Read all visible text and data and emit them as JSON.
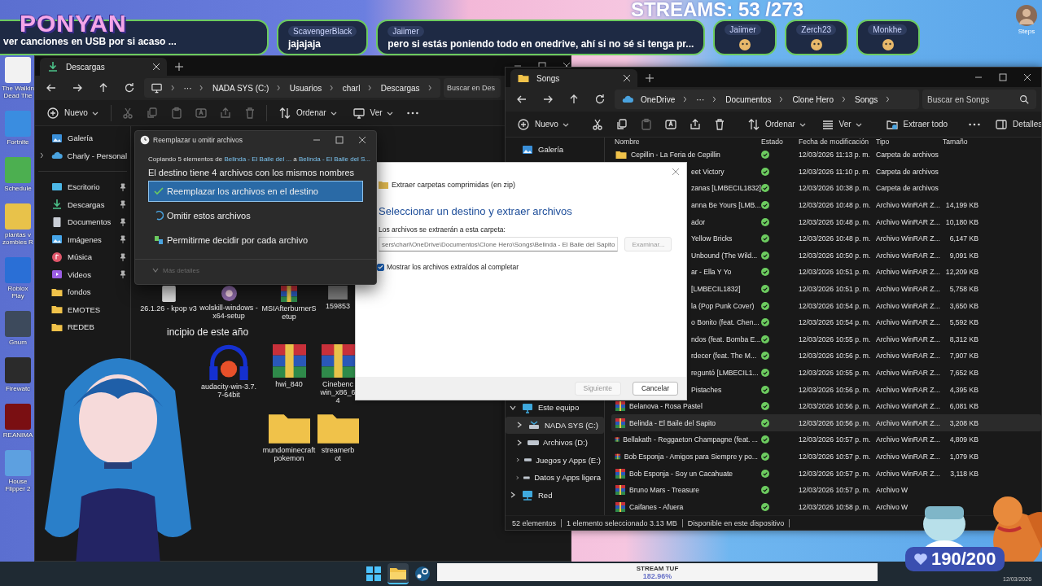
{
  "overlay": {
    "logo": "PONYAN",
    "chat": [
      {
        "kind": "message",
        "text": "ver canciones en USB por si acaso ..."
      },
      {
        "kind": "message",
        "user": "ScavengerBlack",
        "text": "jajajaja"
      },
      {
        "kind": "message",
        "user": "Jaiimer",
        "text": "pero si estás poniendo todo en onedrive, ahí si no sé si tenga pr..."
      },
      {
        "kind": "emote",
        "user": "Jaiimer"
      },
      {
        "kind": "emote",
        "user": "Zerch23"
      },
      {
        "kind": "emote",
        "user": "Monkhe"
      }
    ],
    "streams_counter": "STREAMS: 53 /273",
    "corner_label": "Steps",
    "stream_bar": {
      "label": "STREAM TUF",
      "value": "182.96%",
      "level": 1
    },
    "goal": "190/200",
    "date": "12/03/2026"
  },
  "desktop_icons": [
    {
      "label": "The Walkin Dead The",
      "color": "#f2f2f2"
    },
    {
      "label": "Fortnite",
      "color": "#3a8de0"
    },
    {
      "label": "Schedule",
      "color": "#4caf50"
    },
    {
      "label": "plantas v zombies R",
      "color": "#e8c24a"
    },
    {
      "label": "Roblox Play",
      "color": "#2a6fd6"
    },
    {
      "label": "Gnum",
      "color": "#3d4a5c"
    },
    {
      "label": "Firewatc",
      "color": "#2b2b2b"
    },
    {
      "label": "REANIMA",
      "color": "#7a0f12"
    },
    {
      "label": "House Flipper 2",
      "color": "#5da0e0"
    }
  ],
  "downloads_window": {
    "tab": "Descargas",
    "hidden_crumbs": "···",
    "breadcrumb": [
      "NADA SYS (C:)",
      "Usuarios",
      "charl",
      "Descargas"
    ],
    "search": {
      "placeholder": "Buscar en Des"
    },
    "toolbar": {
      "new": "Nuevo",
      "sort": "Ordenar",
      "view": "Ver"
    },
    "sidebar": [
      {
        "label": "Galería",
        "kind": "gallery",
        "pinned": false
      },
      {
        "label": "Charly - Personal",
        "kind": "cloud",
        "pinned": false
      },
      {
        "label": "Escritorio",
        "kind": "desktop",
        "pinned": true
      },
      {
        "label": "Descargas",
        "kind": "download",
        "pinned": true
      },
      {
        "label": "Documentos",
        "kind": "document",
        "pinned": true
      },
      {
        "label": "Imágenes",
        "kind": "pictures",
        "pinned": true
      },
      {
        "label": "Música",
        "kind": "music",
        "pinned": true
      },
      {
        "label": "Videos",
        "kind": "videos",
        "pinned": true
      },
      {
        "label": "fondos",
        "kind": "folder",
        "pinned": false
      },
      {
        "label": "EMOTES",
        "kind": "folder",
        "pinned": false
      },
      {
        "label": "REDEB",
        "kind": "folder",
        "pinned": false
      }
    ],
    "sections": [
      {
        "items": [
          {
            "kind": "file",
            "label": "26.1.26 - kpop v3"
          },
          {
            "kind": "installer",
            "label": "wolskill-windows -x64-setup"
          },
          {
            "kind": "archive",
            "label": "MSIAfterburnerS etup"
          },
          {
            "kind": "image",
            "label": "159853"
          }
        ]
      },
      {
        "heading": "incipio de este año",
        "items": [
          {
            "kind": "covered"
          },
          {
            "kind": "audio",
            "label": "audacity-win-3.7. 7-64bit"
          },
          {
            "kind": "archive",
            "label": "hwi_840"
          },
          {
            "kind": "archive",
            "label": "Cinebenc win_x86_64"
          }
        ]
      },
      {
        "items": [
          {
            "kind": "covered"
          },
          {
            "kind": "covered"
          },
          {
            "kind": "folder",
            "label": "mundominecraft pokemon"
          },
          {
            "kind": "folder",
            "label": "streamerbot"
          }
        ]
      }
    ]
  },
  "replace_dialog": {
    "title": "Reemplazar u omitir archivos",
    "subtitle": {
      "prefix": "Copiando 5 elementos de ",
      "source": "Belinda - El Baile del ...",
      "middle": " a ",
      "target": "Belinda - El Baile del S..."
    },
    "heading": "El destino tiene 4 archivos con los mismos nombres",
    "options": [
      {
        "kind": "replace",
        "label": "Reemplazar los archivos en el destino",
        "selected": true
      },
      {
        "kind": "skip",
        "label": "Omitir estos archivos",
        "selected": false
      },
      {
        "kind": "decide",
        "label": "Permitirme decidir por cada archivo",
        "selected": false
      }
    ],
    "details": {
      "label": "Más detalles",
      "disabled": true
    }
  },
  "extract_dialog": {
    "title": "Extraer carpetas comprimidas (en zip)",
    "heading": "Seleccionar un destino y extraer archivos",
    "field_label": "Los archivos se extraerán a esta carpeta:",
    "path": "sers\\charl\\OneDrive\\Documentos\\Clone Hero\\Songs\\Belinda - El Baile del Sapito",
    "browse": {
      "label": "Examinar...",
      "disabled": true
    },
    "show_files": {
      "label": "Mostrar los archivos extraídos al completar",
      "checked": true
    },
    "buttons": [
      {
        "label": "Siguiente",
        "disabled": true
      },
      {
        "label": "Cancelar",
        "disabled": false
      }
    ]
  },
  "songs_window": {
    "tab": "Songs",
    "hidden_crumbs": "···",
    "breadcrumb": [
      "OneDrive",
      "Documentos",
      "Clone Hero",
      "Songs"
    ],
    "search": {
      "placeholder": "Buscar en Songs"
    },
    "toolbar": {
      "new": "Nuevo",
      "sort": "Ordenar",
      "view": "Ver",
      "extract": "Extraer todo",
      "details": "Detalles"
    },
    "sidebar_top": [
      {
        "label": "Galería",
        "kind": "gallery"
      }
    ],
    "sidebar_bottom": [
      {
        "label": "Este equipo",
        "kind": "pc",
        "expanded": true,
        "selected": false,
        "children": [
          {
            "label": "NADA SYS (C:)",
            "kind": "system-drive",
            "expanded": false,
            "selected": true
          },
          {
            "label": "Archivos (D:)",
            "kind": "drive",
            "expanded": false,
            "selected": false
          },
          {
            "label": "Juegos y Apps  (E:)",
            "kind": "drive",
            "expanded": false,
            "selected": false
          },
          {
            "label": "Datos y Apps ligera",
            "kind": "drive",
            "expanded": false,
            "selected": false
          }
        ]
      },
      {
        "label": "Red",
        "kind": "network",
        "expanded": false,
        "selected": false
      }
    ],
    "columns": [
      "Nombre",
      "Estado",
      "Fecha de modificación",
      "Tipo",
      "Tamaño"
    ],
    "rows": [
      {
        "kind": "folder",
        "name": "Cepillin - La Feria de Cepillin",
        "synced": true,
        "date": "12/03/2026 11:13 p. m.",
        "type": "Carpeta de archivos",
        "selected": false
      },
      {
        "kind": "partial",
        "name": "eet Victory",
        "synced": true,
        "date": "12/03/2026 11:10 p. m.",
        "type": "Carpeta de archivos",
        "selected": false
      },
      {
        "kind": "partial",
        "name": "zanas [LMBECIL1832]",
        "synced": true,
        "date": "12/03/2026 10:38 p. m.",
        "type": "Carpeta de archivos",
        "selected": false
      },
      {
        "kind": "partial",
        "name": "anna Be Yours [LMB...",
        "synced": true,
        "date": "12/03/2026 10:48 p. m.",
        "type": "Archivo WinRAR Z...",
        "size": "14,199 KB",
        "selected": false
      },
      {
        "kind": "partial",
        "name": "ador",
        "synced": true,
        "date": "12/03/2026 10:48 p. m.",
        "type": "Archivo WinRAR Z...",
        "size": "10,180 KB",
        "selected": false
      },
      {
        "kind": "partial",
        "name": "Yellow Bricks",
        "synced": true,
        "date": "12/03/2026 10:48 p. m.",
        "type": "Archivo WinRAR Z...",
        "size": "6,147 KB",
        "selected": false
      },
      {
        "kind": "partial",
        "name": "Unbound (The Wild...",
        "synced": true,
        "date": "12/03/2026 10:50 p. m.",
        "type": "Archivo WinRAR Z...",
        "size": "9,091 KB",
        "selected": false
      },
      {
        "kind": "partial",
        "name": "ar - Ella Y Yo",
        "synced": true,
        "date": "12/03/2026 10:51 p. m.",
        "type": "Archivo WinRAR Z...",
        "size": "12,209 KB",
        "selected": false
      },
      {
        "kind": "partial",
        "name": "[LMBECIL1832]",
        "synced": true,
        "date": "12/03/2026 10:51 p. m.",
        "type": "Archivo WinRAR Z...",
        "size": "5,758 KB",
        "selected": false
      },
      {
        "kind": "partial",
        "name": "la (Pop Punk Cover)",
        "synced": true,
        "date": "12/03/2026 10:54 p. m.",
        "type": "Archivo WinRAR Z...",
        "size": "3,650 KB",
        "selected": false
      },
      {
        "kind": "partial",
        "name": "o Bonito (feat. Chen...",
        "synced": true,
        "date": "12/03/2026 10:54 p. m.",
        "type": "Archivo WinRAR Z...",
        "size": "5,592 KB",
        "selected": false
      },
      {
        "kind": "partial",
        "name": "ndos (feat. Bomba E...",
        "synced": true,
        "date": "12/03/2026 10:55 p. m.",
        "type": "Archivo WinRAR Z...",
        "size": "8,312 KB",
        "selected": false
      },
      {
        "kind": "partial",
        "name": "rdecer (feat. The M...",
        "synced": true,
        "date": "12/03/2026 10:56 p. m.",
        "type": "Archivo WinRAR Z...",
        "size": "7,907 KB",
        "selected": false
      },
      {
        "kind": "partial",
        "name": "reguntó [LMBECIL1...",
        "synced": true,
        "date": "12/03/2026 10:55 p. m.",
        "type": "Archivo WinRAR Z...",
        "size": "7,652 KB",
        "selected": false
      },
      {
        "kind": "partial",
        "name": "Pistaches",
        "synced": true,
        "date": "12/03/2026 10:56 p. m.",
        "type": "Archivo WinRAR Z...",
        "size": "4,395 KB",
        "selected": false
      },
      {
        "kind": "archive",
        "name": "Belanova - Rosa Pastel",
        "synced": true,
        "date": "12/03/2026 10:56 p. m.",
        "type": "Archivo WinRAR Z...",
        "size": "6,081 KB",
        "selected": false
      },
      {
        "kind": "archive",
        "name": "Belinda - El Baile del Sapito",
        "synced": true,
        "date": "12/03/2026 10:56 p. m.",
        "type": "Archivo WinRAR Z...",
        "size": "3,208 KB",
        "selected": true
      },
      {
        "kind": "archive",
        "name": "Bellakath - Reggaeton Champagne (feat. ...",
        "synced": true,
        "date": "12/03/2026 10:57 p. m.",
        "type": "Archivo WinRAR Z...",
        "size": "4,809 KB",
        "selected": false
      },
      {
        "kind": "archive",
        "name": "Bob Esponja - Amigos para Siempre y po...",
        "synced": true,
        "date": "12/03/2026 10:57 p. m.",
        "type": "Archivo WinRAR Z...",
        "size": "1,079 KB",
        "selected": false
      },
      {
        "kind": "archive",
        "name": "Bob Esponja - Soy un Cacahuate",
        "synced": true,
        "date": "12/03/2026 10:57 p. m.",
        "type": "Archivo WinRAR Z...",
        "size": "3,118 KB",
        "selected": false
      },
      {
        "kind": "archive",
        "name": "Bruno Mars - Treasure",
        "synced": true,
        "date": "12/03/2026 10:57 p. m.",
        "type": "Archivo W",
        "selected": false
      },
      {
        "kind": "archive",
        "name": "Caifanes - Afuera",
        "synced": true,
        "date": "12/03/2026 10:58 p. m.",
        "type": "Archivo W",
        "selected": false
      }
    ],
    "status": [
      "52 elementos",
      "1 elemento seleccionado  3.13 MB",
      "Disponible en este dispositivo"
    ]
  },
  "taskbar": [
    {
      "kind": "start",
      "selected": false
    },
    {
      "kind": "explorer",
      "selected": true
    },
    {
      "kind": "steam",
      "selected": false
    }
  ]
}
